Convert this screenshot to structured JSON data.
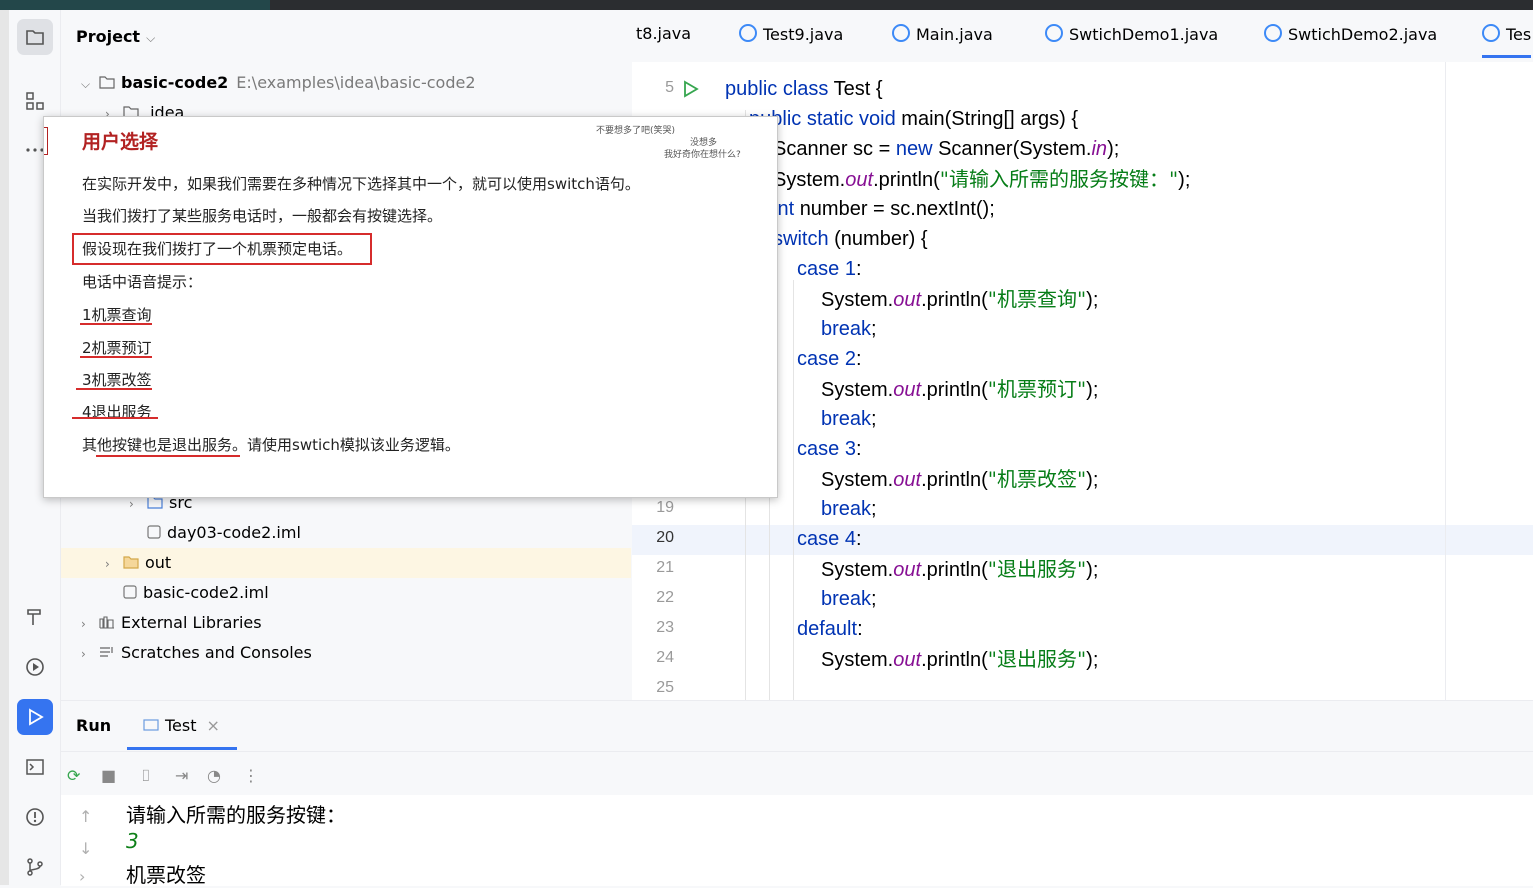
{
  "project": {
    "title": "Project",
    "root_name": "basic-code2",
    "root_path": "E:\\examples\\idea\\basic-code2",
    "idea_folder": ".idea",
    "items": [
      {
        "name": "src"
      },
      {
        "name": "day03-code2.iml"
      },
      {
        "name": "out"
      },
      {
        "name": "basic-code2.iml"
      },
      {
        "name": "External Libraries"
      },
      {
        "name": "Scratches and Consoles"
      }
    ]
  },
  "tabs": [
    "t8.java",
    "Test9.java",
    "Main.java",
    "SwtichDemo1.java",
    "SwtichDemo2.java",
    "Tes"
  ],
  "editor": {
    "line_numbers": [
      "5",
      "19",
      "20",
      "21",
      "22",
      "23",
      "24",
      "25"
    ],
    "lines": [
      {
        "kw": "public class ",
        "rest": "Test {"
      },
      {
        "kw": "public static void ",
        "rest": "main(String[] args) {"
      },
      {
        "pre": "Scanner sc = ",
        "kw": "new ",
        "rest": "Scanner(System.",
        "fld": "in",
        "post": ");"
      },
      {
        "pre": "System.",
        "fld": "out",
        "mid": ".println(",
        "str": "\"请输入所需的服务按键：\"",
        "post": ");"
      },
      {
        "kw": "int ",
        "rest": "number = sc.nextInt();"
      },
      {
        "kw": "switch ",
        "rest": "(number) {"
      },
      {
        "kw": "case ",
        "num": "1",
        "rest": ":"
      },
      {
        "pre": "System.",
        "fld": "out",
        "mid": ".println(",
        "str": "\"机票查询\"",
        "post": ");"
      },
      {
        "kw": "break",
        "rest": ";"
      },
      {
        "kw": "case ",
        "num": "2",
        "rest": ":"
      },
      {
        "pre": "System.",
        "fld": "out",
        "mid": ".println(",
        "str": "\"机票预订\"",
        "post": ");"
      },
      {
        "kw": "break",
        "rest": ";"
      },
      {
        "kw": "case ",
        "num": "3",
        "rest": ":"
      },
      {
        "pre": "System.",
        "fld": "out",
        "mid": ".println(",
        "str": "\"机票改签\"",
        "post": ");"
      },
      {
        "kw": "break",
        "rest": ";"
      },
      {
        "kw": "case ",
        "num": "4",
        "rest": ":"
      },
      {
        "pre": "System.",
        "fld": "out",
        "mid": ".println(",
        "str": "\"退出服务\"",
        "post": ");"
      },
      {
        "kw": "break",
        "rest": ";"
      },
      {
        "kw": "default",
        "rest": ":"
      },
      {
        "pre": "System.",
        "fld": "out",
        "mid": ".println(",
        "str": "\"退出服务\"",
        "post": ");"
      }
    ]
  },
  "popup": {
    "title": "用户选择",
    "lines": [
      "在实际开发中，如果我们需要在多种情况下选择其中一个，就可以使用switch语句。",
      "当我们拨打了某些服务电话时，一般都会有按键选择。",
      "假设现在我们拨打了一个机票预定电话。",
      "电话中语音提示：",
      "1机票查询",
      "2机票预订",
      "3机票改签",
      "4退出服务",
      "其他按键也是退出服务。请使用swtich模拟该业务逻辑。"
    ],
    "danmaku": [
      "不要想多了吧(笑哭)",
      "没想多",
      "我好奇你在想什么?"
    ]
  },
  "run": {
    "title": "Run",
    "tab": "Test",
    "output": [
      "请输入所需的服务按键：",
      "3",
      "机票改签"
    ]
  },
  "colors": {
    "accent": "#3574f0",
    "keyword": "#0033b3",
    "string": "#067d17",
    "field": "#871094",
    "annotation_red": "#d62c2c"
  }
}
